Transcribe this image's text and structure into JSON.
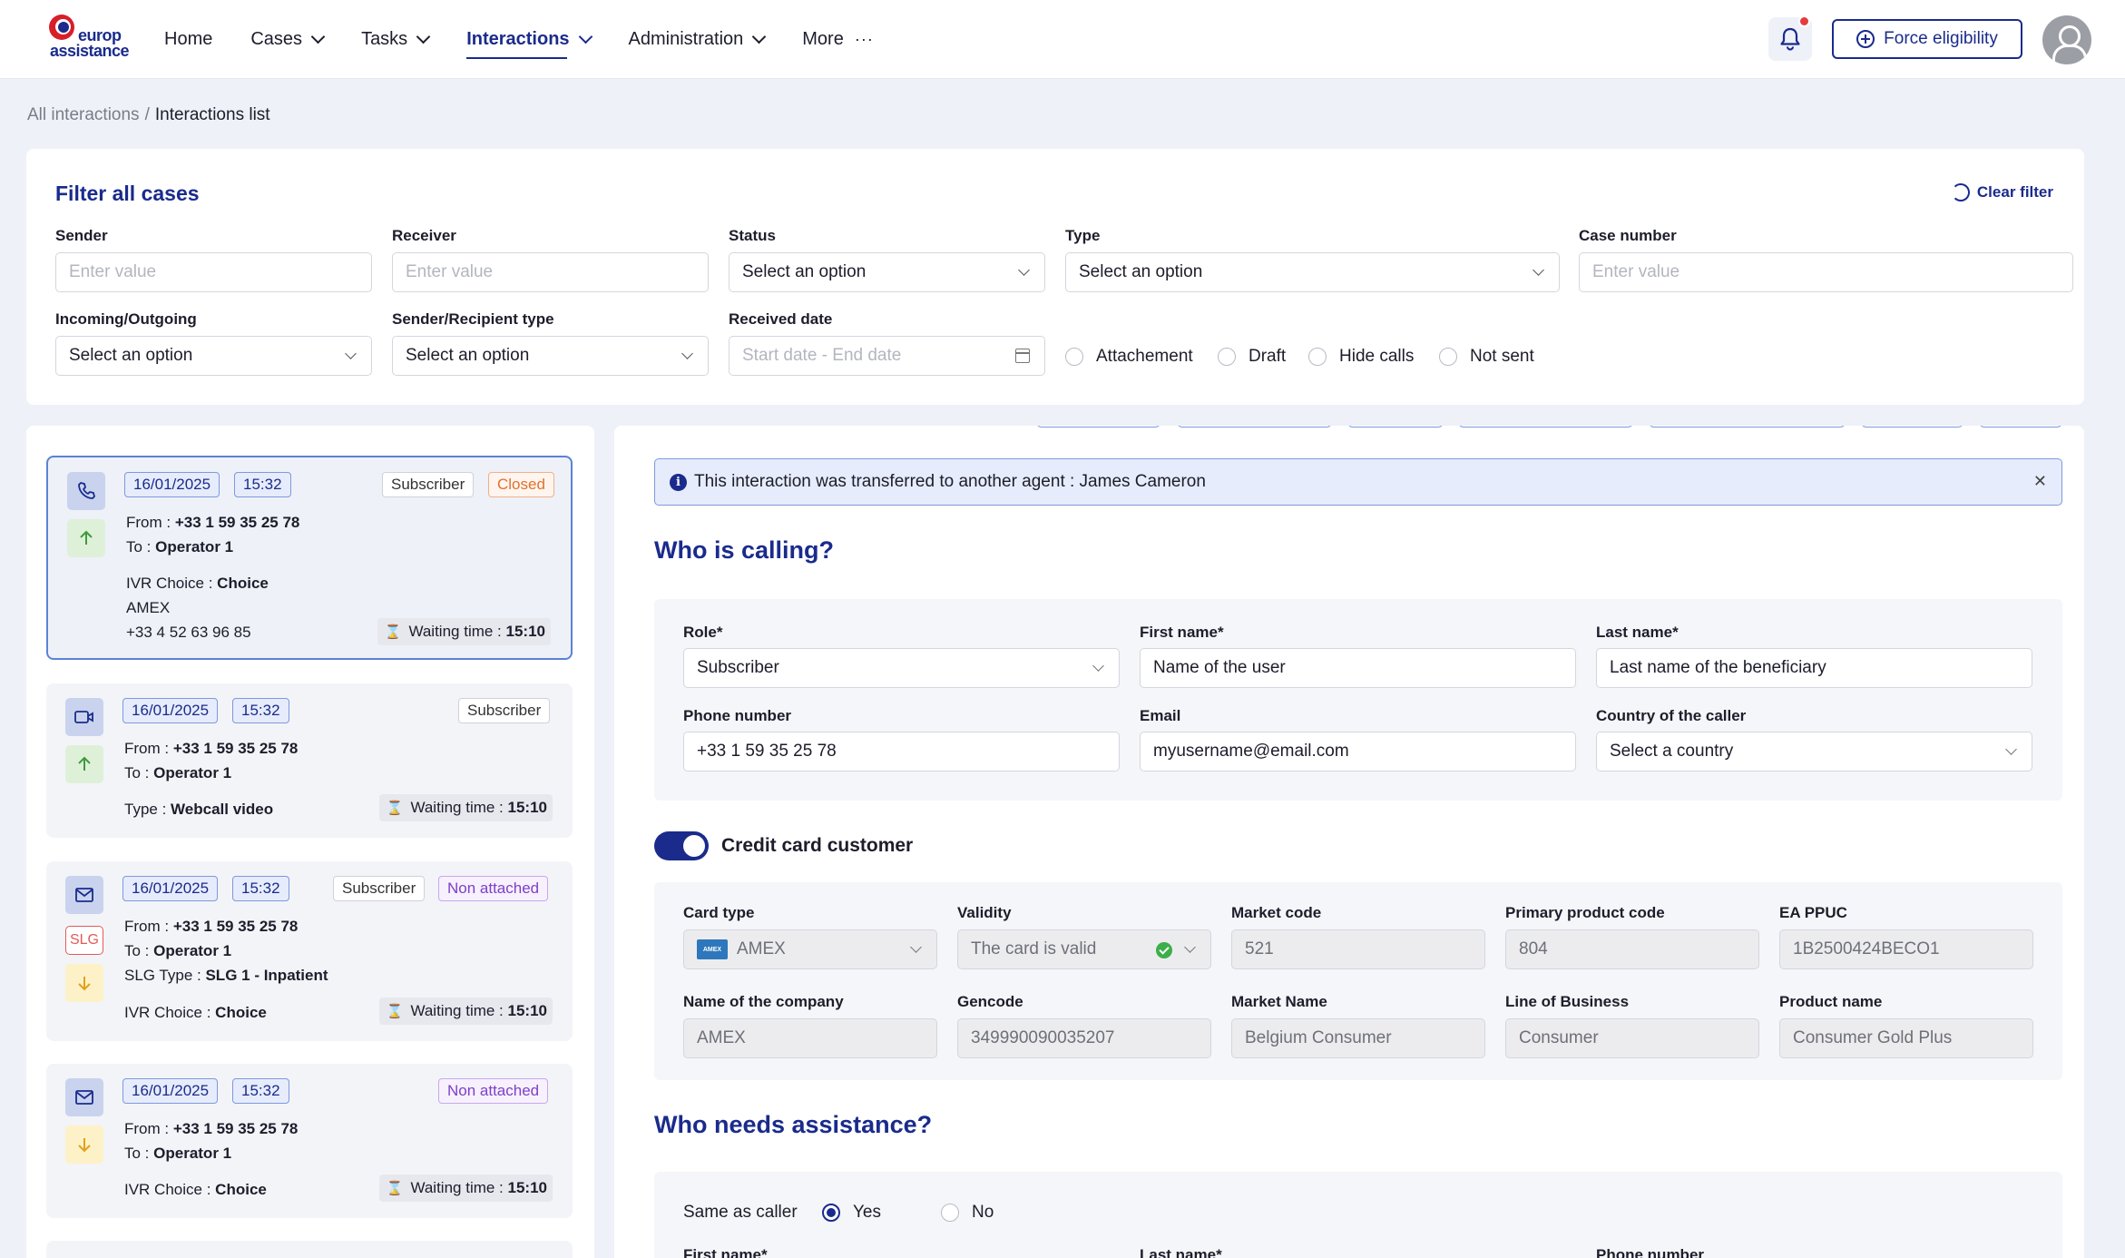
{
  "brand": {
    "line1": "europ",
    "line2": "assistance"
  },
  "nav": {
    "home": "Home",
    "cases": "Cases",
    "tasks": "Tasks",
    "interactions": "Interactions",
    "administration": "Administration",
    "more": "More",
    "more_glyph": "···"
  },
  "header": {
    "force_eligibility": "Force eligibility"
  },
  "breadcrumb": {
    "root": "All interactions",
    "separator": "/",
    "current": "Interactions list"
  },
  "filter": {
    "title": "Filter all cases",
    "clear": "Clear filter",
    "sender_label": "Sender",
    "sender_placeholder": "Enter value",
    "receiver_label": "Receiver",
    "receiver_placeholder": "Enter value",
    "status_label": "Status",
    "status_value": "Select an option",
    "type_label": "Type",
    "type_value": "Select an option",
    "case_number_label": "Case number",
    "case_number_placeholder": "Enter value",
    "inout_label": "Incoming/Outgoing",
    "inout_value": "Select an option",
    "srtype_label": "Sender/Recipient type",
    "srtype_value": "Select an option",
    "received_label": "Received date",
    "received_placeholder": "Start date - End date",
    "checks": [
      "Attachement",
      "Draft",
      "Hide calls",
      "Not sent"
    ]
  },
  "interactions": [
    {
      "date": "16/01/2025",
      "time": "15:32",
      "tag1": "Subscriber",
      "status": "Closed",
      "from_label": "From :",
      "from": "+33 1 59 35 25 78",
      "to_label": "To :",
      "to": "Operator 1",
      "ivr_label": "IVR Choice :",
      "ivr": "Choice",
      "extra1": "AMEX",
      "extra2": "+33 4 52 63 96 85",
      "wait_label": "Waiting time :",
      "wait": "15:10"
    },
    {
      "date": "16/01/2025",
      "time": "15:32",
      "tag1": "Subscriber",
      "from_label": "From :",
      "from": "+33 1 59 35 25 78",
      "to_label": "To :",
      "to": "Operator 1",
      "type_label": "Type :",
      "type": "Webcall video",
      "wait_label": "Waiting time :",
      "wait": "15:10"
    },
    {
      "date": "16/01/2025",
      "time": "15:32",
      "tag1": "Subscriber",
      "status": "Non attached",
      "badge": "SLG",
      "from_label": "From :",
      "from": "+33 1 59 35 25 78",
      "to_label": "To :",
      "to": "Operator 1",
      "slg_label": "SLG Type :",
      "slg": "SLG 1 - Inpatient",
      "ivr_label": "IVR Choice :",
      "ivr": "Choice",
      "wait_label": "Waiting time :",
      "wait": "15:10"
    },
    {
      "date": "16/01/2025",
      "time": "15:32",
      "status": "Non attached",
      "from_label": "From :",
      "from": "+33 1 59 35 25 78",
      "to_label": "To :",
      "to": "Operator 1",
      "ivr_label": "IVR Choice :",
      "ivr": "Choice",
      "wait_label": "Waiting time :",
      "wait": "15:10"
    }
  ],
  "detail": {
    "banner": "This interaction was transferred to another agent : James Cameron",
    "banner_close": "✕",
    "who_calling": "Who is calling?",
    "role_label": "Role*",
    "role_value": "Subscriber",
    "first_name_label": "First name*",
    "first_name_value": "Name of the user",
    "last_name_label": "Last name*",
    "last_name_value": "Last name of the beneficiary",
    "phone_label": "Phone number",
    "phone_value": "+33 1 59 35 25 78",
    "email_label": "Email",
    "email_value": "myusername@email.com",
    "country_label": "Country of the caller",
    "country_value": "Select a country",
    "cc_toggle": "Credit card customer",
    "card_type_label": "Card type",
    "card_type_value": "AMEX",
    "validity_label": "Validity",
    "validity_value": "The card is valid",
    "market_code_label": "Market code",
    "market_code_value": "521",
    "ppc_label": "Primary product code",
    "ppc_value": "804",
    "eappuc_label": "EA PPUC",
    "eappuc_value": "1B2500424BECO1",
    "company_label": "Name of the company",
    "company_value": "AMEX",
    "gencode_label": "Gencode",
    "gencode_value": "349990090035207",
    "market_name_label": "Market Name",
    "market_name_value": "Belgium Consumer",
    "lob_label": "Line of Business",
    "lob_value": "Consumer",
    "product_label": "Product name",
    "product_value": "Consumer Gold Plus",
    "who_needs": "Who needs assistance?",
    "same_caller_label": "Same as caller",
    "yes": "Yes",
    "no": "No",
    "first_name2_label": "First name*",
    "last_name2_label": "Last name*",
    "phone2_label": "Phone number"
  },
  "colors": {
    "brand_blue": "#1a2b8c",
    "accent_red": "#d71f2a",
    "closed_orange": "#e1712f",
    "non_attached_purple": "#7e3fc9"
  }
}
